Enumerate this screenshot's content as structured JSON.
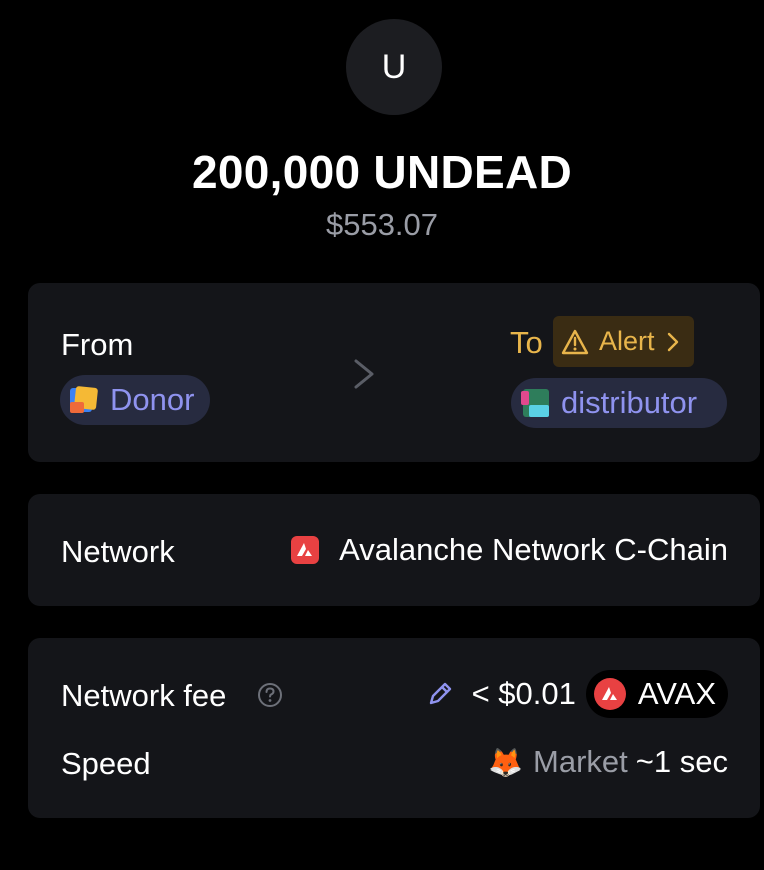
{
  "token": {
    "avatar_letter": "U",
    "amount": "200,000 UNDEAD",
    "usd_value": "$553.07"
  },
  "transfer": {
    "from_label": "From",
    "from_name": "Donor",
    "to_label": "To",
    "alert_label": "Alert",
    "to_name": "distributor"
  },
  "network": {
    "label": "Network",
    "value": "Avalanche Network C-Chain"
  },
  "fee": {
    "label": "Network fee",
    "amount": "< $0.01",
    "token": "AVAX",
    "speed_label": "Speed",
    "speed_name": "Market",
    "speed_time": "~1 sec"
  },
  "icons": {
    "avax_badge": "avalanche-logo-icon",
    "edit": "pencil-icon",
    "help": "question-circle-icon",
    "speed": "fox-emoji-icon"
  },
  "colors": {
    "background": "#000000",
    "card": "#141519",
    "accent_purple": "#8f93ef",
    "warning": "#e8b54b",
    "avax_red": "#e84142",
    "muted": "#9a9da6"
  }
}
